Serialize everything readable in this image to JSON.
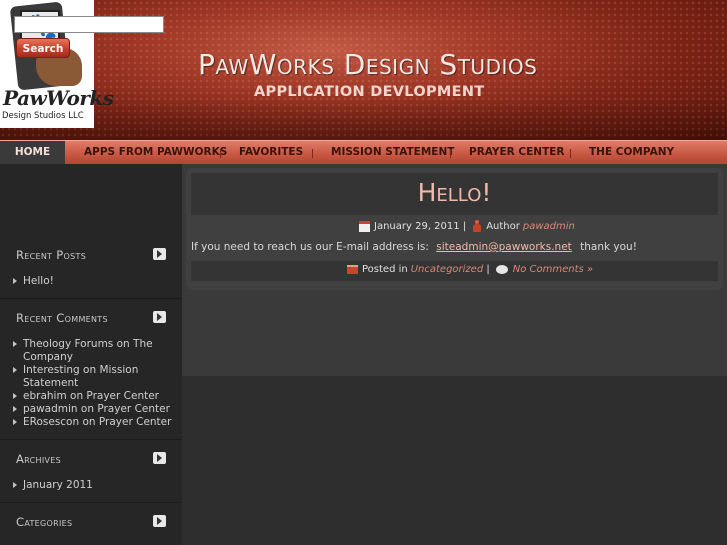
{
  "logo": {
    "brand": "PawWorks",
    "sub": "Design Studios LLC"
  },
  "header": {
    "title": "PawWorks Design Studios",
    "tagline": "APPLICATION DEVLOPMENT"
  },
  "nav": {
    "items": [
      "HOME",
      "APPS FROM PAWWORKS",
      "FAVORITES",
      "MISSION STATEMENT",
      "PRAYER CENTER",
      "THE COMPANY"
    ],
    "active": "HOME"
  },
  "search": {
    "button_label": "Search",
    "value": ""
  },
  "sidebar": {
    "recent_posts": {
      "title": "Recent Posts",
      "items": [
        "Hello!"
      ]
    },
    "recent_comments": {
      "title": "Recent Comments",
      "items": [
        "Theology Forums on The Company",
        "Interesting on Mission Statement",
        "ebrahim on Prayer Center",
        "pawadmin on Prayer Center",
        "ERosescon on Prayer Center"
      ]
    },
    "archives": {
      "title": "Archives",
      "items": [
        "January 2011"
      ]
    },
    "categories": {
      "title": "Categories"
    }
  },
  "post": {
    "title": "Hello!",
    "date": "January 29, 2011",
    "author_label": "Author",
    "author": "pawadmin",
    "body_before": "If you need to reach us our E-mail address is:",
    "email": "siteadmin@pawworks.net",
    "body_after": "thank you!",
    "posted_in_label": "Posted in",
    "category": "Uncategorized",
    "comments_link": "No Comments »"
  },
  "colors": {
    "accent": "#c85945",
    "link": "#d68a76",
    "title": "#f2b9a8",
    "background": "#2e2e2e"
  }
}
